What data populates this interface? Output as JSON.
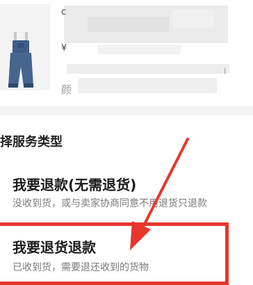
{
  "product": {
    "glyph_top": "c",
    "glyph_mid": "¥",
    "color_label": "颜",
    "edge_mark": "Ⅰ"
  },
  "section": {
    "title": "择服务类型"
  },
  "options": [
    {
      "title": "我要退款(无需退货)",
      "description": "没收到货，或与卖家协商同意不用退货只退款"
    },
    {
      "title": "我要退货退款",
      "description": "已收到货，需要退还收到的货物"
    }
  ],
  "annotation": {
    "highlight_color": "#e8362b",
    "arrow_color": "#e8362b"
  }
}
